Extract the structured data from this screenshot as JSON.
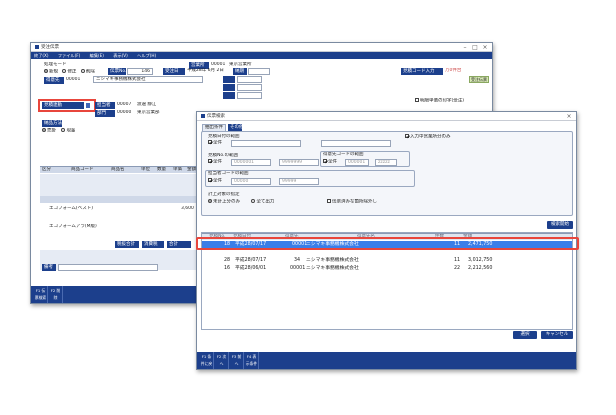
{
  "back_window": {
    "title": "受注伝票",
    "menu_items": [
      "終了(X)",
      "ファイル(F)",
      "編集(E)",
      "表示(V)",
      "ヘルプ(H)"
    ],
    "process_mode_label": "処理モード",
    "mode_new": "新規",
    "mode_edit": "修正",
    "mode_delete": "削除",
    "slip_no_label": "伝票No.",
    "slip_no_value": "146",
    "order_date_label": "受注日",
    "order_date_value": "平成28年 6月 2日",
    "sales_office_label": "営業所",
    "sales_office_code": "00001",
    "sales_office_name": "東京営業所",
    "delivery_label": "納期",
    "customer_label": "得意先",
    "customer_code": "00001",
    "customer_name": "ニシマキ事務機株式会社",
    "estimate_ref_label": "見積連動",
    "rep_label": "担当者",
    "rep_code": "00007",
    "rep_name": "渡邉 静江",
    "dept_label": "部門",
    "dept_code": "00000",
    "dept_name": "東京営業部",
    "status_right_label": "見積コード入力",
    "status_right_value": "万0件台",
    "status_badge": "受注伝票",
    "print_option_label": "明細単価の印字(受注)",
    "tax_label": "納品方法",
    "tax_mode_a": "売掛",
    "tax_mode_b": "現金",
    "item_header": [
      "区分",
      "商品コード",
      "商品名",
      "単位",
      "数量",
      "単価",
      "金額"
    ],
    "item_row_name": "エコフォーム(ベスト)",
    "item_row_qty": "3,600",
    "item_row2_name": "エコフォームアラ(M版)",
    "footer_total_label": "税抜合計",
    "footer_tax_label": "消費税",
    "footer_grand_label": "合計",
    "memo_label": "備考",
    "fkeys": [
      "F1 伝票検索",
      "F2 削除"
    ]
  },
  "dialog": {
    "title": "伝票検索",
    "criteria_tab": "抽出条件",
    "criteria_tab2": "その他",
    "date_range_label": "見積日付の範囲",
    "all_label": "全件",
    "input_office_only": "入力中営業所分のみ",
    "slip_range_label": "見積No.の範囲",
    "customer_range_label": "得意先コードの範囲",
    "from_ph": "0000001",
    "to_ph": "9999999",
    "cust_from": "000001",
    "cust_to": "zzzzz",
    "rep_range_label": "担当者コードの範囲",
    "rep_from": "00000",
    "rep_to": "99999",
    "target_label": "計上対象の指定",
    "target_unposted": "未計上分のみ",
    "target_all": "全て出力",
    "skip_posted": "伝票済みな箇所除外し",
    "search_button": "検索開始",
    "columns": [
      "見積No.",
      "見積日付",
      "得意先",
      "得意先名",
      "件数",
      "金額"
    ],
    "rows": [
      {
        "no": "18",
        "date": "平成28/07/17",
        "code": "00001",
        "name": "ニシマキ事務機株式会社",
        "count": "11",
        "amount": "2,471,750"
      },
      {
        "no": "",
        "date": "",
        "code": "",
        "name": "",
        "count": "",
        "amount": ""
      },
      {
        "no": "28",
        "date": "平成28/07/17",
        "code": "34",
        "name": "ニシマキ事務機株式会社",
        "count": "11",
        "amount": "3,012,750"
      },
      {
        "no": "16",
        "date": "平成28/06/01",
        "code": "00001",
        "name": "ニシマキ事務機株式会社",
        "count": "22",
        "amount": "2,212,560"
      }
    ],
    "ok_button": "選択",
    "cancel_button": "キャンセル",
    "fkeys": [
      "F1 条件に戻る",
      "F2 次へ",
      "F3 前へ",
      "F4 表示条件"
    ]
  },
  "colors": {
    "brand": "#1c3f8c",
    "highlight": "#e8463c",
    "selected_row": "#3b7ee8"
  }
}
